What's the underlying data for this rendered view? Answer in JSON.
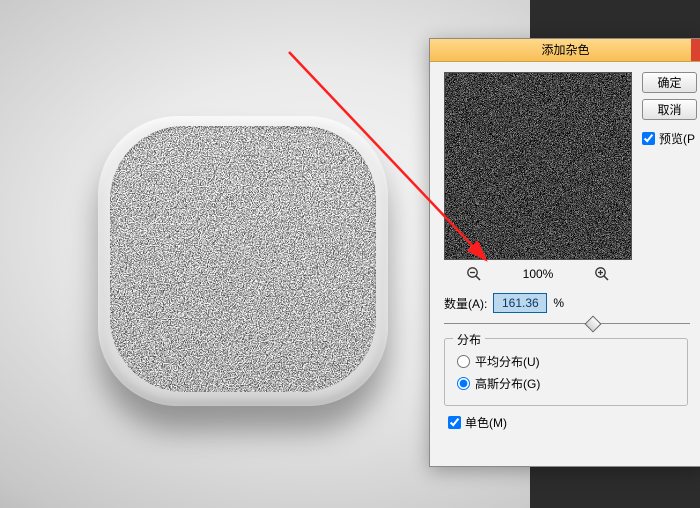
{
  "dialog": {
    "title": "添加杂色",
    "ok_label": "确定",
    "cancel_label": "取消",
    "preview_checkbox": "预览(P",
    "zoom_label": "100%",
    "amount_label": "数量(A):",
    "amount_value": "161.36",
    "amount_unit": "%",
    "distribution": {
      "legend": "分布",
      "uniform": "平均分布(U)",
      "gaussian": "高斯分布(G)",
      "selected": "gaussian"
    },
    "monochrome": "单色(M)",
    "slider_percent": 60
  }
}
